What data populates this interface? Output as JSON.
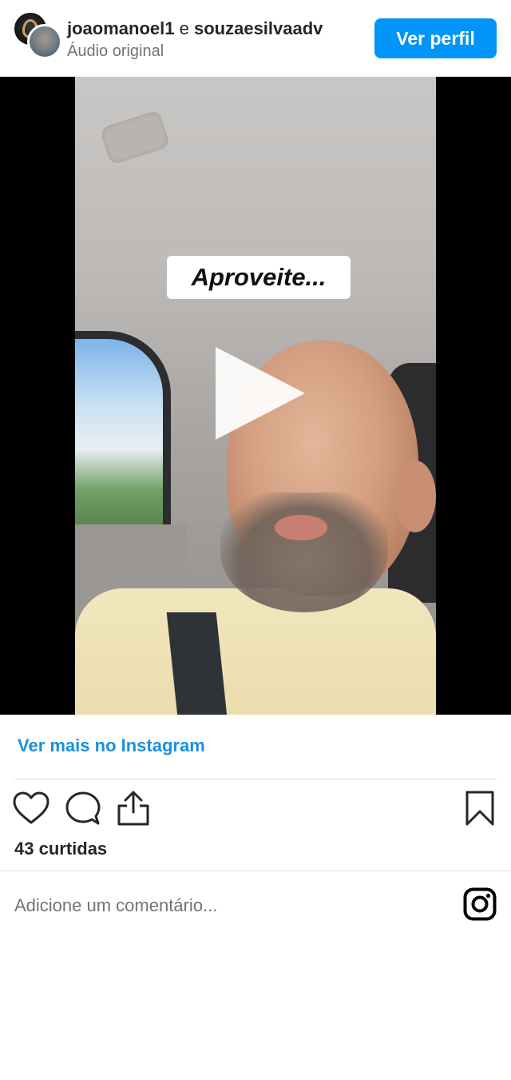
{
  "header": {
    "user1": "joaomanoel1",
    "joiner": "e",
    "user2": "souzaesilvaadv",
    "audio": "Áudio original",
    "profile_button": "Ver perfil"
  },
  "video": {
    "caption": "Aproveite..."
  },
  "footer": {
    "more_link": "Ver mais no Instagram",
    "likes": "43 curtidas",
    "comment_placeholder": "Adicione um comentário..."
  },
  "icons": {
    "like": "heart-icon",
    "comment": "comment-bubble-icon",
    "share": "share-icon",
    "save": "bookmark-icon",
    "brand": "instagram-logo-icon"
  },
  "colors": {
    "accent": "#0095f6",
    "link": "#1a8fdb",
    "muted": "#737373",
    "text": "#262626"
  }
}
